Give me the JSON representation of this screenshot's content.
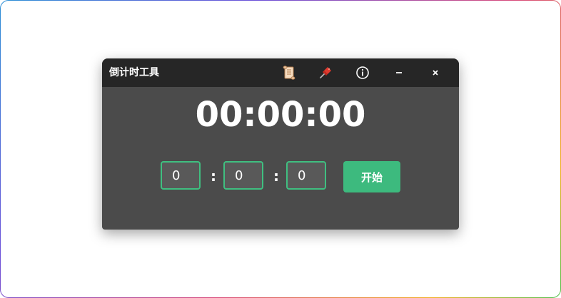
{
  "window": {
    "title": "倒计时工具"
  },
  "titlebar": {
    "icons": [
      "scroll-icon",
      "pushpin-icon",
      "info-icon",
      "minimize-icon",
      "close-icon"
    ]
  },
  "timer": {
    "display": "00:00:00"
  },
  "inputs": {
    "hours": "0",
    "minutes": "0",
    "seconds": "0",
    "separator": ":"
  },
  "actions": {
    "start_label": "开始"
  },
  "colors": {
    "accent": "#3dba7e",
    "titlebar": "#262626",
    "window_bg": "#4b4b4b"
  }
}
